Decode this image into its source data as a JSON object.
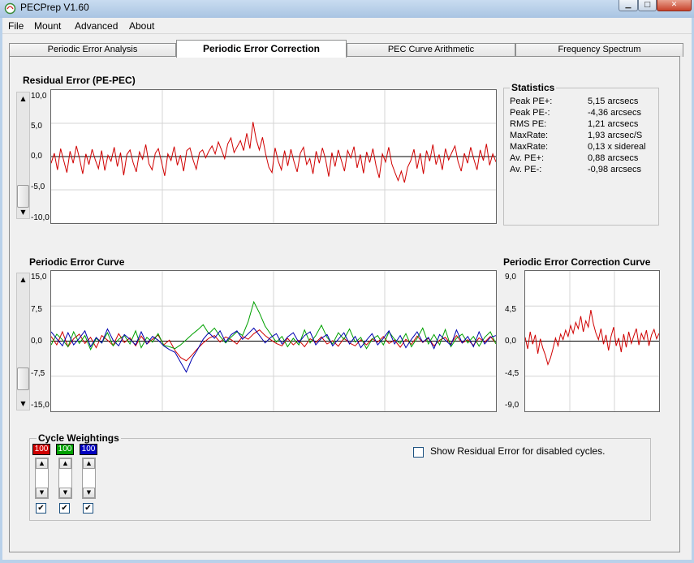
{
  "window": {
    "title": "PECPrep V1.60"
  },
  "menu": [
    "File",
    "Mount",
    "Advanced",
    "About"
  ],
  "tabs": [
    {
      "label": "Periodic Error Analysis",
      "active": false
    },
    {
      "label": "Periodic Error Correction",
      "active": true
    },
    {
      "label": "PEC Curve Arithmetic",
      "active": false
    },
    {
      "label": "Frequency Spectrum",
      "active": false
    }
  ],
  "residual": {
    "title": "Residual Error (PE-PEC)",
    "yticks": [
      "10,0",
      "5,0",
      "0,0",
      "-5,0",
      "-10,0"
    ],
    "chart_data": {
      "type": "line",
      "ylim": [
        -10,
        10
      ],
      "series": [
        {
          "color": "#d00000",
          "values": [
            -1.0,
            0.5,
            -2.0,
            1.2,
            -0.6,
            -2.4,
            0.8,
            -1.0,
            1.6,
            -0.3,
            -2.6,
            0.4,
            -1.2,
            1.1,
            -0.5,
            -1.8,
            0.9,
            -2.1,
            0.2,
            -0.7,
            1.4,
            -1.5,
            0.6,
            -2.8,
            0.3,
            1.0,
            -0.9,
            -2.3,
            0.7,
            -0.4,
            1.8,
            -1.1,
            -2.0,
            0.5,
            1.2,
            -0.8,
            -2.9,
            0.4,
            -0.6,
            1.5,
            -1.3,
            0.2,
            -2.2,
            0.9,
            1.3,
            -0.5,
            -1.9,
            0.6,
            1.0,
            -0.2,
            0.8,
            1.6,
            0.4,
            2.2,
            1.0,
            -0.3,
            1.9,
            2.8,
            0.6,
            1.5,
            2.4,
            0.9,
            3.5,
            1.2,
            5.2,
            2.6,
            1.0,
            2.9,
            0.4,
            -1.6,
            -2.4,
            1.3,
            -0.7,
            -2.0,
            0.9,
            -1.4,
            1.1,
            -0.8,
            -2.3,
            0.5,
            1.4,
            -1.2,
            -0.3,
            -2.6,
            0.8,
            -1.0,
            1.3,
            -0.4,
            -3.0,
            0.6,
            -1.5,
            1.0,
            -0.6,
            -2.2,
            0.9,
            -0.2,
            1.5,
            -1.7,
            0.3,
            -2.5,
            0.7,
            -0.9,
            1.2,
            -1.4,
            -3.2,
            0.4,
            -0.8,
            1.4,
            -1.1,
            -2.4,
            -3.6,
            -2.2,
            -3.9,
            -1.6,
            -0.6,
            1.1,
            -1.8,
            0.5,
            -2.6,
            0.9,
            -0.7,
            1.8,
            -1.2,
            0.3,
            -2.0,
            1.2,
            -0.5,
            0.6,
            1.6,
            -0.8,
            -2.2,
            0.5,
            -1.0,
            1.4,
            -0.4,
            -2.0,
            1.0,
            -0.6,
            1.9,
            -1.3,
            0.4,
            -0.8
          ]
        }
      ]
    }
  },
  "statistics": {
    "title": "Statistics",
    "rows": [
      {
        "label": "Peak PE+:",
        "value": "5,15 arcsecs"
      },
      {
        "label": "Peak PE-:",
        "value": "-4,36 arcsecs"
      },
      {
        "label": "RMS PE:",
        "value": "1,21 arcsecs"
      },
      {
        "label": "MaxRate:",
        "value": "1,93 arcsec/S"
      },
      {
        "label": "MaxRate:",
        "value": "0,13 x sidereal"
      },
      {
        "label": "Av. PE+:",
        "value": "0,88 arcsecs"
      },
      {
        "label": "Av. PE-:",
        "value": "-0,98 arcsecs"
      }
    ]
  },
  "pe_curve": {
    "title": "Periodic Error Curve",
    "yticks": [
      "15,0",
      "7,5",
      "0,0",
      "-7,5",
      "-15,0"
    ],
    "chart_data": {
      "type": "line",
      "ylim": [
        -15,
        15
      ],
      "series": [
        {
          "color": "#d00000",
          "values": [
            1.0,
            -0.8,
            2.0,
            -1.2,
            0.5,
            1.5,
            -0.5,
            0.8,
            -1.4,
            1.2,
            0.2,
            -0.9,
            1.6,
            -0.3,
            0.7,
            -1.0,
            1.1,
            -0.6,
            0.4,
            1.3,
            -0.8,
            0.2,
            -2.0,
            -3.5,
            -4.2,
            -3.0,
            -1.6,
            -0.4,
            0.6,
            1.2,
            -0.2,
            0.9,
            0.3,
            -0.6,
            1.0,
            0.4,
            1.6,
            2.4,
            1.2,
            0.3,
            -0.5,
            -1.0,
            0.6,
            -0.8,
            0.2,
            -1.2,
            0.5,
            -0.3,
            0.9,
            -0.6,
            0.1,
            -1.1,
            0.6,
            -0.4,
            -1.0,
            0.3,
            -0.8,
            0.5,
            -0.2,
            1.0,
            -0.5,
            0.2,
            -1.3,
            0.4,
            -0.7,
            1.1,
            -0.3,
            0.6,
            -1.0,
            0.2,
            0.8,
            -0.6,
            1.2,
            -0.4,
            0.3,
            -0.9,
            0.7,
            -0.2,
            1.0,
            -0.5
          ]
        },
        {
          "color": "#00a000",
          "values": [
            -0.8,
            1.5,
            0.3,
            -1.2,
            2.0,
            -0.5,
            1.2,
            -1.8,
            0.6,
            -0.4,
            1.8,
            -1.0,
            0.4,
            1.2,
            -0.6,
            2.2,
            -1.4,
            0.8,
            -0.2,
            1.6,
            -0.9,
            -1.2,
            -1.6,
            -0.8,
            0.3,
            1.4,
            2.4,
            3.5,
            1.6,
            2.8,
            1.0,
            -0.4,
            0.9,
            2.0,
            1.2,
            4.2,
            8.4,
            6.0,
            3.2,
            1.5,
            -0.2,
            1.0,
            -1.2,
            0.6,
            -0.8,
            2.4,
            -0.4,
            1.2,
            3.4,
            0.8,
            -0.6,
            1.8,
            0.4,
            2.6,
            -0.2,
            0.8,
            -1.6,
            0.4,
            1.2,
            -0.8,
            2.0,
            0.4,
            -0.5,
            1.6,
            -1.2,
            0.6,
            2.8,
            -0.6,
            1.4,
            -0.8,
            2.5,
            -1.2,
            0.6,
            1.5,
            -0.4,
            1.0,
            -1.1,
            0.8,
            2.0,
            -0.6
          ]
        },
        {
          "color": "#0000b0",
          "values": [
            2.0,
            0.5,
            -1.0,
            1.8,
            -0.8,
            0.6,
            2.2,
            -1.2,
            0.8,
            -0.4,
            2.6,
            0.2,
            -1.0,
            1.4,
            0.4,
            -0.8,
            2.0,
            -0.6,
            1.0,
            0.2,
            -1.0,
            -1.8,
            -2.4,
            -4.5,
            -6.6,
            -3.8,
            -1.8,
            0.4,
            1.8,
            0.6,
            2.2,
            -0.2,
            1.4,
            2.2,
            0.4,
            1.6,
            2.8,
            1.2,
            -0.4,
            0.8,
            1.6,
            -0.6,
            0.9,
            1.8,
            -0.3,
            1.2,
            2.0,
            -0.8,
            0.6,
            1.4,
            -1.0,
            0.4,
            1.8,
            -0.6,
            1.0,
            -1.4,
            0.2,
            1.6,
            -0.8,
            0.6,
            2.2,
            -0.6,
            1.2,
            -1.4,
            0.4,
            2.0,
            -0.2,
            0.8,
            -1.6,
            1.4,
            0.2,
            -0.9,
            2.4,
            -0.4,
            1.0,
            -1.2,
            2.0,
            -0.6,
            0.8,
            1.2
          ]
        }
      ]
    }
  },
  "pec_curve": {
    "title": "Periodic Error Correction Curve",
    "yticks": [
      "9,0",
      "4,5",
      "0,0",
      "-4,5",
      "-9,0"
    ],
    "chart_data": {
      "type": "line",
      "ylim": [
        -9,
        9
      ],
      "series": [
        {
          "color": "#d00000",
          "values": [
            0.5,
            -1.0,
            1.2,
            -0.4,
            0.8,
            -1.6,
            0.3,
            -0.9,
            -1.8,
            -3.0,
            -2.2,
            -1.0,
            0.4,
            -0.6,
            0.9,
            0.2,
            1.4,
            0.6,
            2.0,
            1.0,
            2.4,
            1.6,
            3.2,
            1.2,
            2.6,
            1.8,
            4.0,
            2.2,
            1.0,
            0.2,
            1.6,
            -0.4,
            0.8,
            -1.2,
            0.6,
            1.8,
            -0.6,
            0.4,
            -1.4,
            0.9,
            -0.8,
            1.2,
            -0.3,
            0.7,
            1.6,
            -0.5,
            1.0,
            0.2,
            1.4,
            -0.6,
            0.8,
            1.5,
            0.3,
            1.0
          ]
        }
      ]
    }
  },
  "weightings": {
    "title": "Cycle Weightings",
    "items": [
      {
        "value": "100",
        "color": "#d00000"
      },
      {
        "value": "100",
        "color": "#00a000"
      },
      {
        "value": "100",
        "color": "#0000c0"
      }
    ]
  },
  "show_residual": {
    "label": "Show Residual Error for disabled cycles."
  }
}
